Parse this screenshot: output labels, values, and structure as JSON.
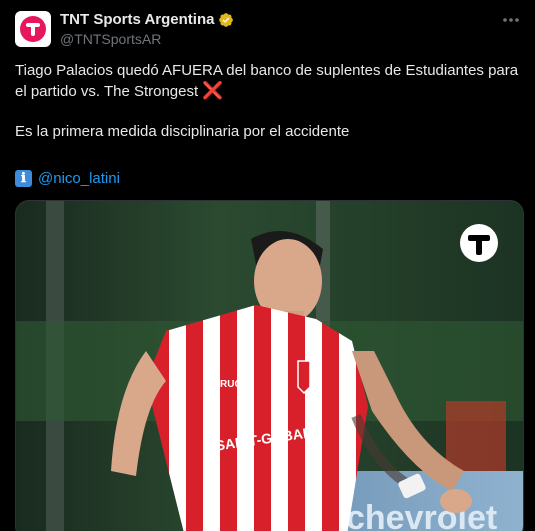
{
  "tweet": {
    "author": {
      "display_name": "TNT Sports Argentina",
      "handle": "@TNTSportsAR",
      "verified": true,
      "verified_color": "#e2b719"
    },
    "more_icon": "more-icon",
    "text_line1": "Tiago Palacios quedó AFUERA del banco de suplentes de Estudiantes para el partido vs. The Strongest",
    "cross_emoji": "❌",
    "text_line2": "Es la primera medida disciplinaria por el accidente",
    "credit_icon": "ℹ",
    "credit_mention": "@nico_latini"
  },
  "media": {
    "sponsor_text": "SAINT-GOBAIN",
    "kit_brand": "RUGE",
    "banner_text": "chevrolet"
  },
  "colors": {
    "background": "#000000",
    "text": "#e7e9ea",
    "secondary": "#71767b",
    "link": "#1d9bf0",
    "brand": "#e6175c"
  }
}
